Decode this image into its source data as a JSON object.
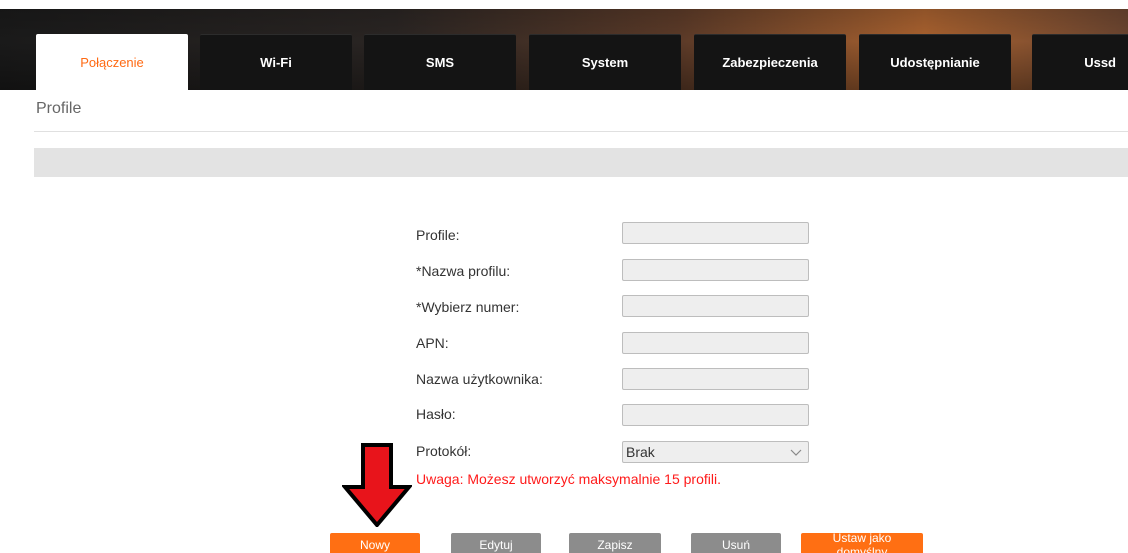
{
  "tabs": [
    {
      "label": "Połączenie",
      "active": true
    },
    {
      "label": "Wi-Fi",
      "active": false
    },
    {
      "label": "SMS",
      "active": false
    },
    {
      "label": "System",
      "active": false
    },
    {
      "label": "Zabezpieczenia",
      "active": false
    },
    {
      "label": "Udostępnianie",
      "active": false
    },
    {
      "label": "Ussd",
      "active": false
    }
  ],
  "section": {
    "title": "Profile"
  },
  "form": {
    "profile_label": "Profile:",
    "profile_value": "",
    "name_label": "*Nazwa profilu:",
    "name_value": "",
    "dial_label": "*Wybierz numer:",
    "dial_value": "",
    "apn_label": "APN:",
    "apn_value": "",
    "user_label": "Nazwa użytkownika:",
    "user_value": "",
    "password_label": "Hasło:",
    "password_value": "",
    "protocol_label": "Protokół:",
    "protocol_selected": "Brak"
  },
  "warning": "Uwaga: Możesz utworzyć maksymalnie 15 profili.",
  "buttons": {
    "new": "Nowy",
    "edit": "Edytuj",
    "save": "Zapisz",
    "delete": "Usuń",
    "set_default": "Ustaw jako domyślny"
  },
  "colors": {
    "accent": "#ff6f13",
    "warning": "#ff1a1a",
    "disabled_button": "#8c8c8c",
    "arrow": "#e8141b"
  },
  "icons": {
    "select": "chevron-down-icon",
    "annotation": "down-arrow-icon"
  }
}
